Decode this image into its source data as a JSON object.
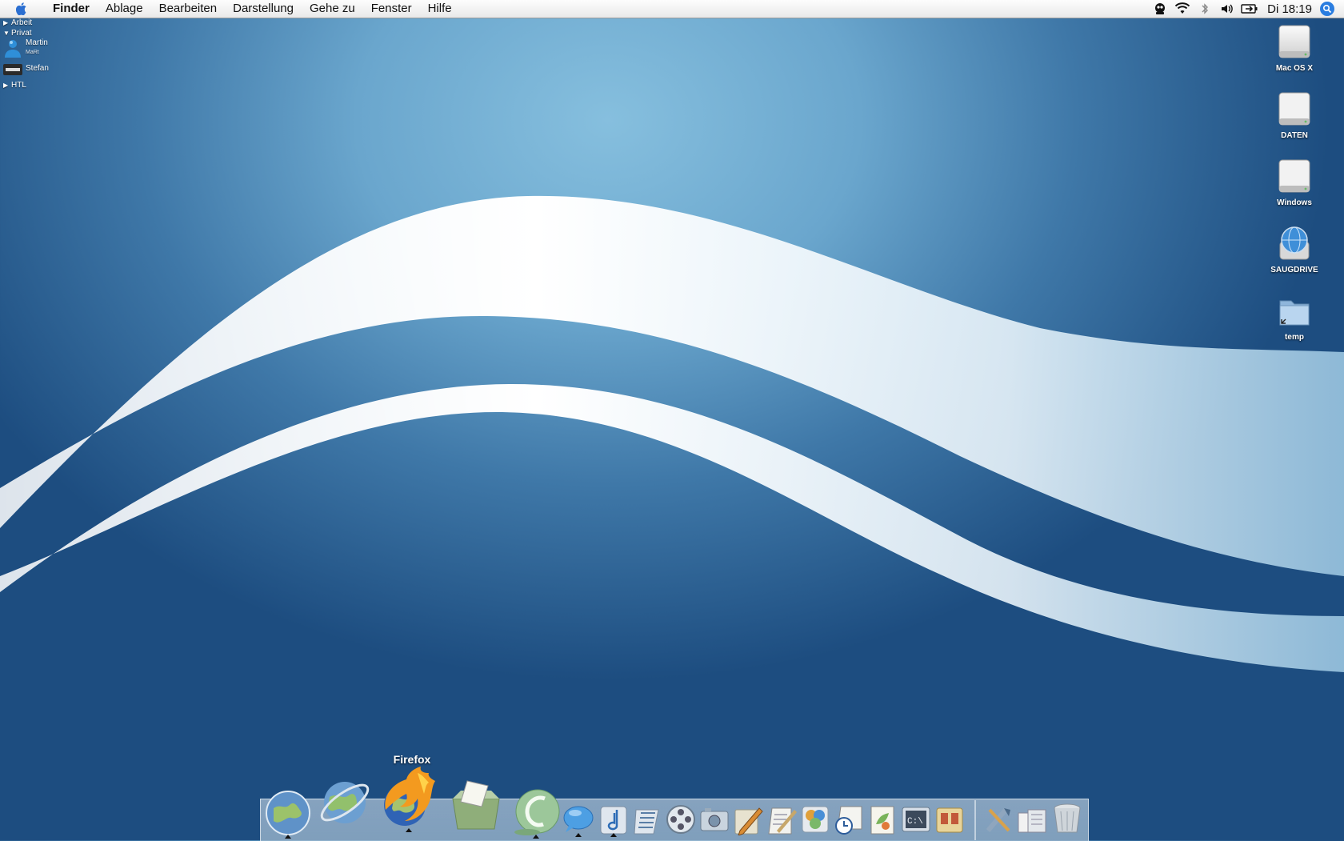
{
  "menubar": {
    "app_name": "Finder",
    "items": [
      "Ablage",
      "Bearbeiten",
      "Darstellung",
      "Gehe zu",
      "Fenster",
      "Hilfe"
    ],
    "clock": "Di 18:19",
    "status_icons": [
      "adium-icon",
      "wifi-icon",
      "bluetooth-icon",
      "volume-icon",
      "battery-icon",
      "spotlight-icon"
    ]
  },
  "buddy_list": {
    "groups": [
      {
        "name": "Arbeit",
        "expanded": false
      },
      {
        "name": "Privat",
        "expanded": true
      },
      {
        "name": "HTL",
        "expanded": false
      }
    ],
    "contacts": [
      {
        "name": "Martin",
        "status": "MaRt"
      },
      {
        "name": "Stefan",
        "status": ""
      }
    ]
  },
  "desktop_icons": [
    {
      "label": "Mac OS X",
      "icon": "hard-drive-icon"
    },
    {
      "label": "DATEN",
      "icon": "hard-drive-icon"
    },
    {
      "label": "Windows",
      "icon": "hard-drive-icon"
    },
    {
      "label": "SAUGDRIVE",
      "icon": "network-drive-icon"
    },
    {
      "label": "temp",
      "icon": "folder-alias-icon"
    }
  ],
  "dock": {
    "tooltip": "Firefox",
    "items": [
      {
        "icon": "globe-browser-icon",
        "running": true
      },
      {
        "icon": "camino-icon",
        "running": false
      },
      {
        "icon": "firefox-icon",
        "running": true
      },
      {
        "icon": "mail-stamp-icon",
        "running": false
      },
      {
        "icon": "adium-icon",
        "running": true
      },
      {
        "icon": "ichat-icon",
        "running": true
      },
      {
        "icon": "itunes-icon",
        "running": true
      },
      {
        "icon": "imovie-icon",
        "running": false
      },
      {
        "icon": "dvd-player-icon",
        "running": false
      },
      {
        "icon": "iphoto-icon",
        "running": false
      },
      {
        "icon": "pencil-app-icon",
        "running": false
      },
      {
        "icon": "textedit-icon",
        "running": false
      },
      {
        "icon": "puzzle-app-icon",
        "running": false
      },
      {
        "icon": "clock-app-icon",
        "running": false
      },
      {
        "icon": "preview-icon",
        "running": false
      },
      {
        "icon": "terminal-icon",
        "running": false
      },
      {
        "icon": "notes-app-icon",
        "running": false
      },
      {
        "icon": "utilities-icon",
        "running": false
      },
      {
        "icon": "documents-stack-icon",
        "running": false
      },
      {
        "icon": "trash-icon",
        "running": false
      }
    ]
  },
  "colors": {
    "wallpaper_light": "#86bfde",
    "wallpaper_dark": "#1d4d80",
    "swoosh": "#ffffff",
    "spotlight": "#2a7de0"
  }
}
